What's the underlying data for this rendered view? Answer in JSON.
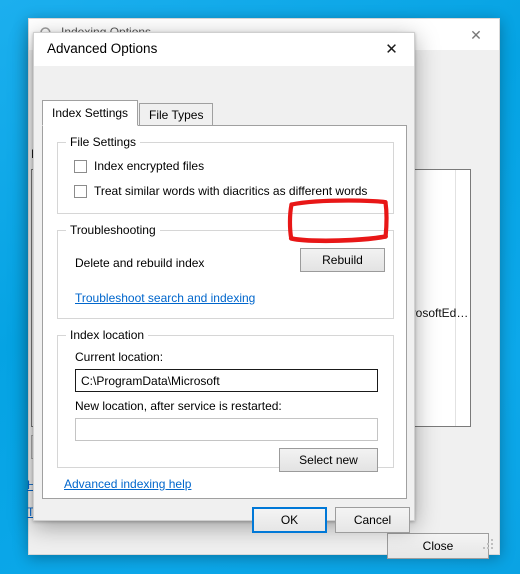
{
  "desktop": {
    "background_color": "#0aa4e6"
  },
  "background_window": {
    "title": "Indexing Options",
    "title_icon": "magnifier-icon",
    "close_icon": "✕",
    "indexed_label": "In",
    "list_item_partial": "MicrosoftEd…",
    "link_1": "H",
    "link_2": "T",
    "close_button_label": "Close"
  },
  "dialog": {
    "title": "Advanced Options",
    "close_icon": "✕",
    "tabs": [
      {
        "label": "Index Settings",
        "active": true
      },
      {
        "label": "File Types",
        "active": false
      }
    ],
    "file_settings": {
      "legend": "File Settings",
      "checkboxes": [
        {
          "label": "Index encrypted files",
          "checked": false
        },
        {
          "label": "Treat similar words with diacritics as different words",
          "checked": false
        }
      ]
    },
    "troubleshooting": {
      "legend": "Troubleshooting",
      "description": "Delete and rebuild index",
      "rebuild_button": "Rebuild",
      "link": "Troubleshoot search and indexing"
    },
    "index_location": {
      "legend": "Index location",
      "current_label": "Current location:",
      "current_value": "C:\\ProgramData\\Microsoft",
      "new_label": "New location, after service is restarted:",
      "new_value": "",
      "new_placeholder": "",
      "select_new_button": "Select new"
    },
    "help_link": "Advanced indexing help",
    "footer": {
      "ok_label": "OK",
      "cancel_label": "Cancel"
    }
  },
  "annotation": {
    "type": "hand-drawn-rectangle",
    "color": "#e81717",
    "target": "Rebuild"
  }
}
